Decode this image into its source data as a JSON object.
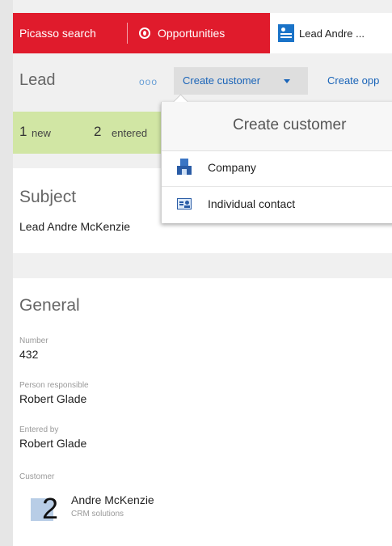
{
  "topbar": {
    "search_tab": "Picasso search",
    "opportunities_tab": "Opportunities",
    "lead_tab": "Lead Andre ..."
  },
  "toolbar": {
    "title": "Lead",
    "more": "ooo",
    "create_customer": "Create customer",
    "create_opportunity": "Create opp"
  },
  "status": {
    "new_count": "1",
    "new_label": "new",
    "entered_count": "2",
    "entered_label": "entered"
  },
  "subject": {
    "heading": "Subject",
    "value": "Lead Andre McKenzie"
  },
  "general": {
    "heading": "General",
    "number_label": "Number",
    "number_value": "432",
    "responsible_label": "Person responsible",
    "responsible_value": "Robert Glade",
    "entered_by_label": "Entered by",
    "entered_by_value": "Robert Glade",
    "customer_label": "Customer",
    "customer_name": "Andre McKenzie",
    "customer_company": "CRM solutions"
  },
  "overlay_number": "2",
  "dropdown": {
    "title": "Create customer",
    "items": [
      {
        "label": "Company",
        "icon": "company-icon"
      },
      {
        "label": "Individual contact",
        "icon": "contact-card-icon"
      }
    ]
  },
  "colors": {
    "brand_red": "#e01b2c",
    "link_blue": "#1a64b8",
    "status_green": "#d1e6a4"
  }
}
